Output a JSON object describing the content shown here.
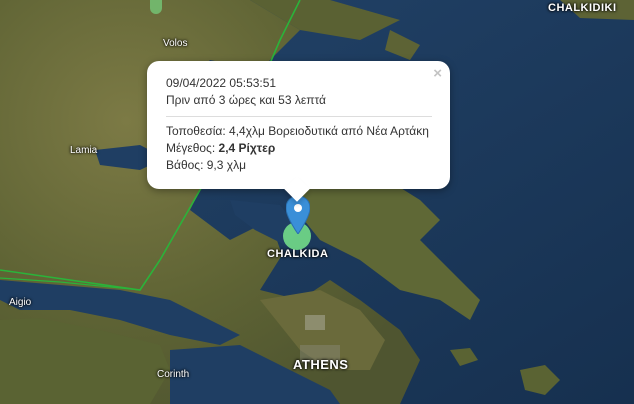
{
  "map": {
    "labels": {
      "volos": "Volos",
      "lamia": "Lamia",
      "aigio": "Aigio",
      "corinth": "Corinth",
      "chalkida": "CHALKIDA",
      "athens": "ATHENS",
      "chalkidiki": "CHALKIDIKI"
    },
    "colors": {
      "sea": "#1b3a5c",
      "land": "#6b6a3a",
      "boundary": "#2bb33a",
      "pin": "#3a8fd8",
      "epicenter": "#78e68c"
    }
  },
  "popup": {
    "datetime": "09/04/2022 05:53:51",
    "ago": "Πριν από 3 ώρες και 53 λεπτά",
    "location_label": "Τοποθεσία:",
    "location_value": "4,4χλμ Βορειοδυτικά από Νέα Αρτάκη",
    "magnitude_label": "Μέγεθος:",
    "magnitude_value": "2,4 Ρίχτερ",
    "depth_label": "Βάθος:",
    "depth_value": "9,3 χλμ",
    "close_icon": "×"
  }
}
